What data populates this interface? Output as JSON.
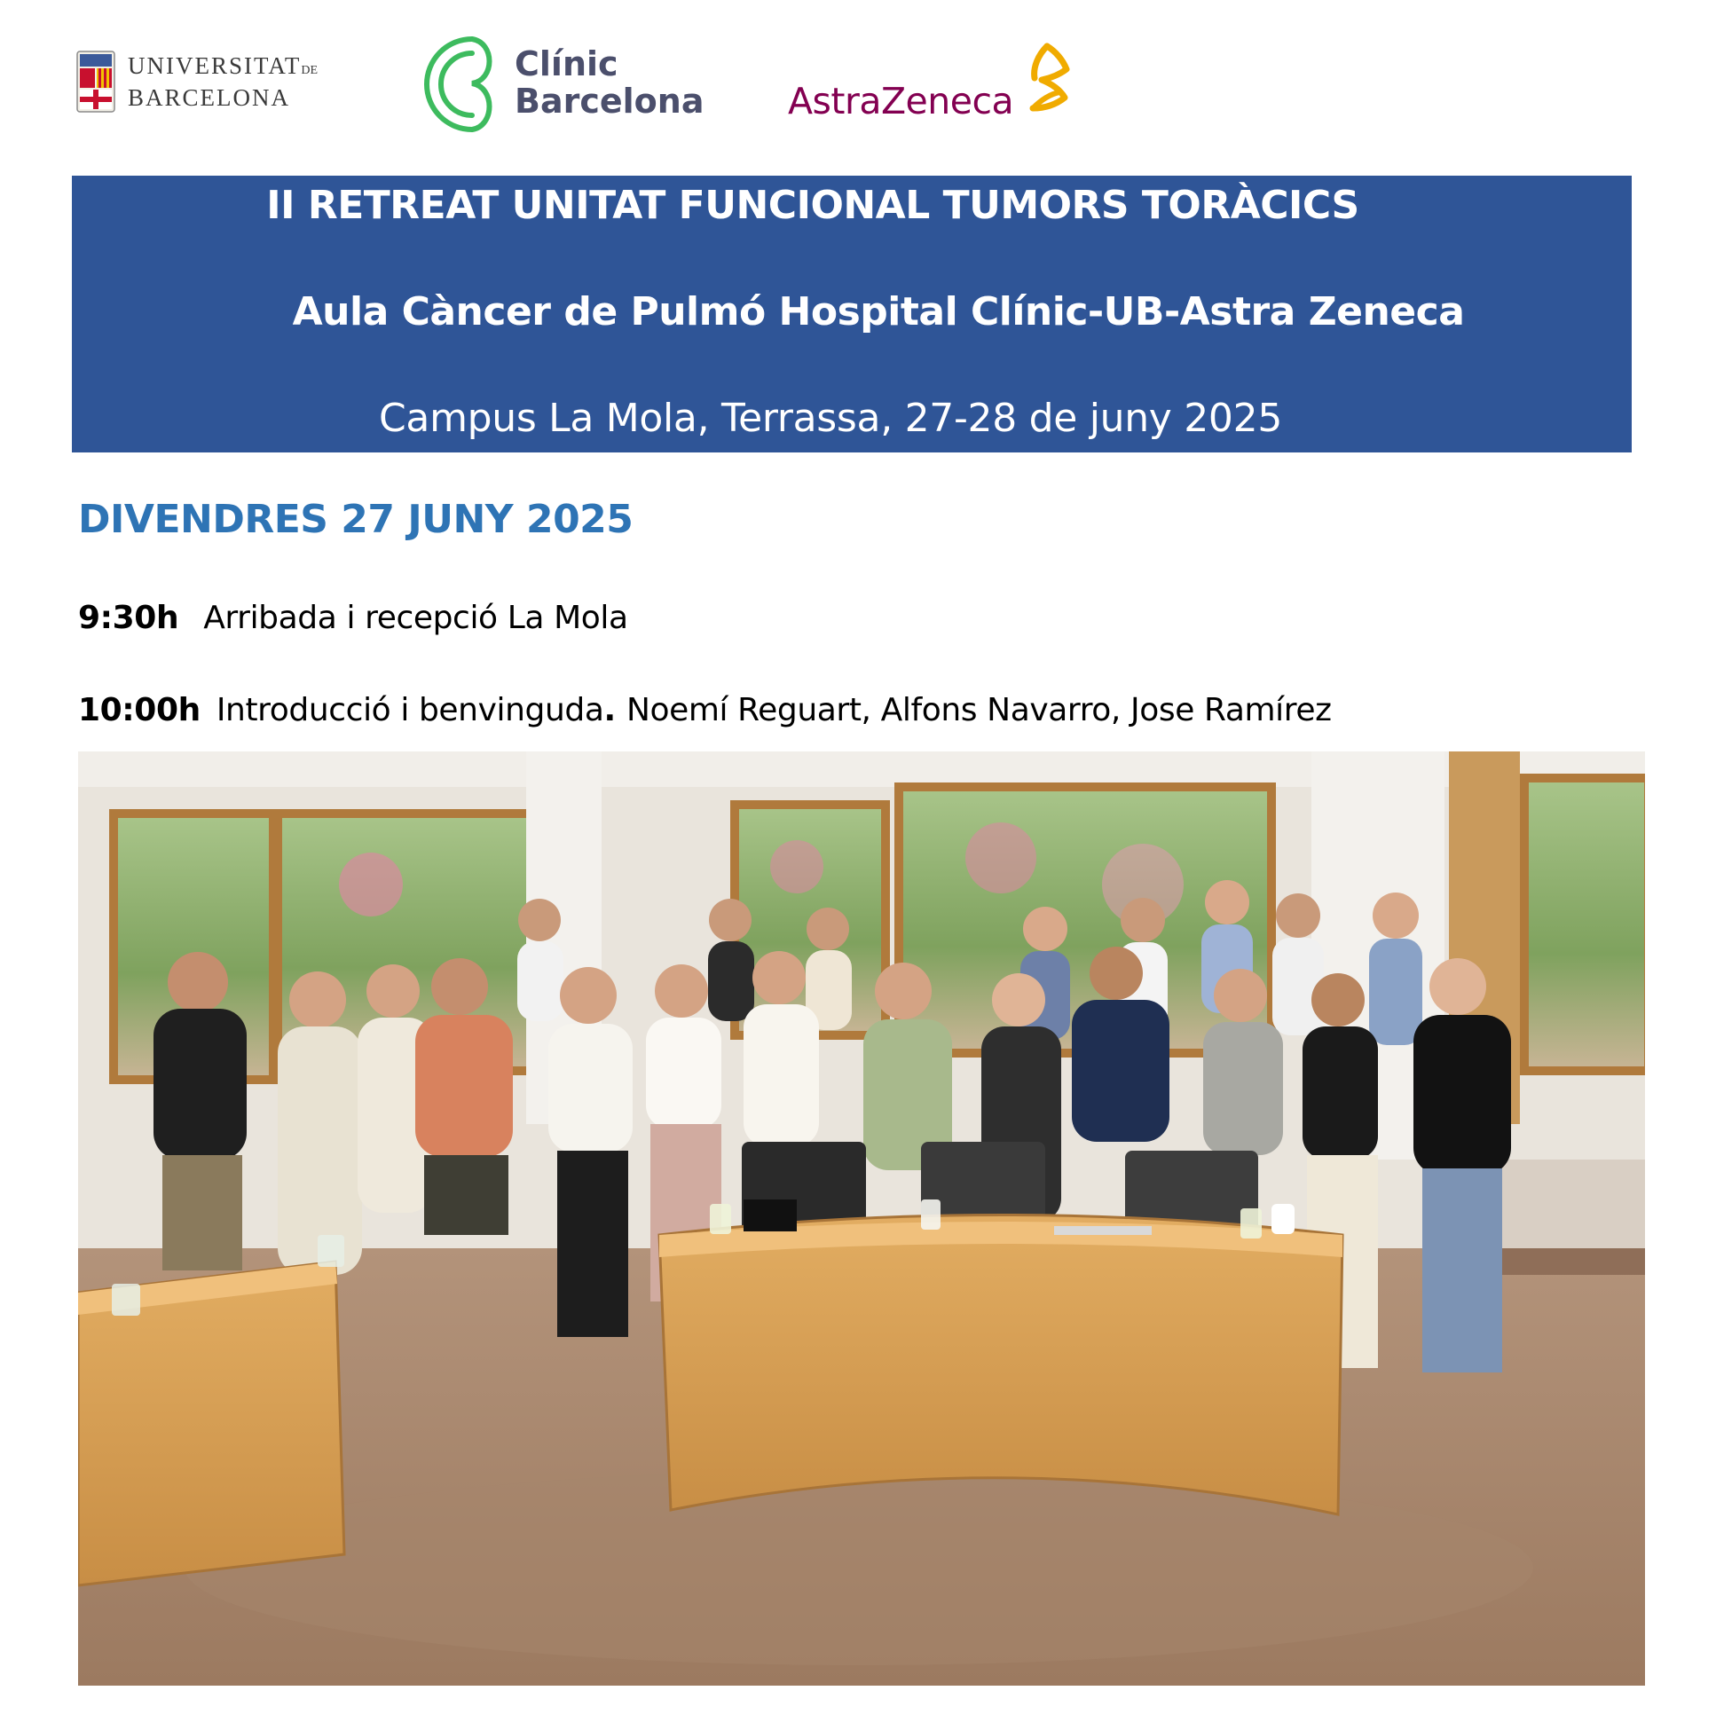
{
  "logos": {
    "ub": {
      "line1": "UNIVERSITAT",
      "line1_suffix": "DE",
      "line2": "BARCELONA"
    },
    "clinic": {
      "line1": "Clínic",
      "line2": "Barcelona",
      "color": "#3dbb5e"
    },
    "astrazeneca": {
      "name": "AstraZeneca",
      "color": "#830051",
      "mark_color": "#f0ab00"
    }
  },
  "banner": {
    "title": "II RETREAT UNITAT FUNCIONAL TUMORS TORÀCICS",
    "subtitle": "Aula Càncer de Pulmó Hospital Clínic-UB-Astra Zeneca",
    "location": "Campus La Mola, Terrassa, 27-28 de juny 2025",
    "background": "#2f5597"
  },
  "day": {
    "heading": "DIVENDRES 27 JUNY 2025",
    "color": "#2e74b5"
  },
  "agenda": [
    {
      "time": "9:30h",
      "description": "Arribada i recepció La Mola",
      "speakers": ""
    },
    {
      "time": "10:00h",
      "description": "Introducció i benvinguda",
      "speakers": "Noemí Reguart, Alfons Navarro, Jose Ramírez"
    }
  ]
}
